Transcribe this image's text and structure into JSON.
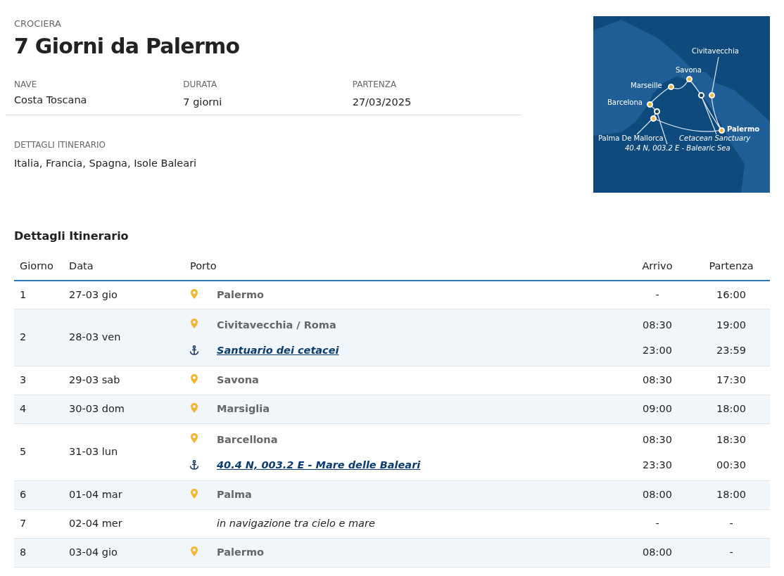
{
  "header": {
    "eyebrow": "CROCIERA",
    "title": "7 Giorni da Palermo"
  },
  "facts": [
    {
      "label": "NAVE",
      "value": "Costa Toscana"
    },
    {
      "label": "DURATA",
      "value": "7 giorni"
    },
    {
      "label": "PARTENZA",
      "value": "27/03/2025"
    }
  ],
  "itinerary_summary": {
    "label": "DETTAGLI ITINERARIO",
    "value": "Italia, Francia, Spagna, Isole Baleari"
  },
  "map": {
    "labels": [
      {
        "text": "Civitavecchia",
        "kind": "port"
      },
      {
        "text": "Savona",
        "kind": "port"
      },
      {
        "text": "Marseille",
        "kind": "port"
      },
      {
        "text": "Barcelona",
        "kind": "port"
      },
      {
        "text": "Palermo",
        "kind": "home"
      },
      {
        "text": "Palma De Mallorca",
        "kind": "port"
      },
      {
        "text": "Cetacean Sanctuary",
        "kind": "sea"
      },
      {
        "text": "40.4 N, 003.2 E - Balearic Sea",
        "kind": "sea"
      }
    ]
  },
  "section_title": "Dettagli Itinerario",
  "table": {
    "columns": [
      "Giorno",
      "Data",
      "Porto",
      "Arrivo",
      "Partenza"
    ],
    "rows": [
      {
        "day": "1",
        "date": "27-03 gio",
        "stops": [
          {
            "kind": "port",
            "name": "Palermo",
            "arrival": "-",
            "departure": "16:00"
          }
        ]
      },
      {
        "day": "2",
        "date": "28-03 ven",
        "stops": [
          {
            "kind": "port",
            "name": "Civitavecchia / Roma",
            "arrival": "08:30",
            "departure": "19:00"
          },
          {
            "kind": "anchor",
            "name": "Santuario dei cetacei",
            "arrival": "23:00",
            "departure": "23:59"
          }
        ]
      },
      {
        "day": "3",
        "date": "29-03 sab",
        "stops": [
          {
            "kind": "port",
            "name": "Savona",
            "arrival": "08:30",
            "departure": "17:30"
          }
        ]
      },
      {
        "day": "4",
        "date": "30-03 dom",
        "stops": [
          {
            "kind": "port",
            "name": "Marsiglia",
            "arrival": "09:00",
            "departure": "18:00"
          }
        ]
      },
      {
        "day": "5",
        "date": "31-03 lun",
        "stops": [
          {
            "kind": "port",
            "name": "Barcellona",
            "arrival": "08:30",
            "departure": "18:30"
          },
          {
            "kind": "anchor",
            "name": "40.4 N, 003.2 E - Mare delle Baleari",
            "arrival": "23:30",
            "departure": "00:30"
          }
        ]
      },
      {
        "day": "6",
        "date": "01-04 mar",
        "stops": [
          {
            "kind": "port",
            "name": "Palma",
            "arrival": "08:00",
            "departure": "18:00"
          }
        ]
      },
      {
        "day": "7",
        "date": "02-04 mer",
        "stops": [
          {
            "kind": "sea",
            "name": "in navigazione tra cielo e mare",
            "arrival": "-",
            "departure": "-"
          }
        ]
      },
      {
        "day": "8",
        "date": "03-04 gio",
        "stops": [
          {
            "kind": "port",
            "name": "Palermo",
            "arrival": "08:00",
            "departure": "-"
          }
        ]
      }
    ]
  }
}
